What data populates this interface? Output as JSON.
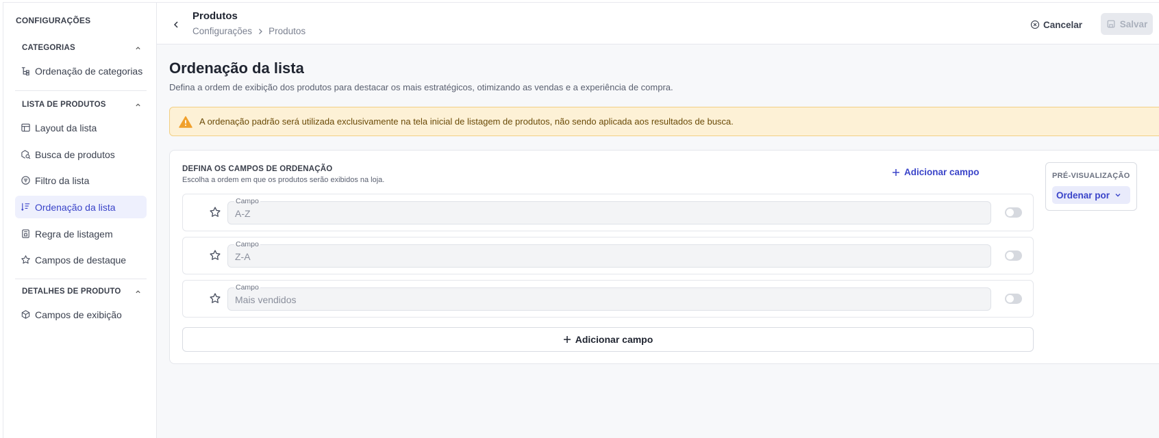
{
  "sidebar": {
    "title": "CONFIGURAÇÕES",
    "sections": [
      {
        "label": "CATEGORIAS",
        "items": [
          {
            "label": "Ordenação de categorias",
            "icon": "sort-tree-icon"
          }
        ]
      },
      {
        "label": "LISTA DE PRODUTOS",
        "items": [
          {
            "label": "Layout da lista",
            "icon": "layout-icon"
          },
          {
            "label": "Busca de produtos",
            "icon": "search-box-icon"
          },
          {
            "label": "Filtro da lista",
            "icon": "filter-icon"
          },
          {
            "label": "Ordenação da lista",
            "icon": "sort-list-icon",
            "active": true
          },
          {
            "label": "Regra de listagem",
            "icon": "rule-icon"
          },
          {
            "label": "Campos de destaque",
            "icon": "star-icon"
          }
        ]
      },
      {
        "label": "DETALHES DE PRODUTO",
        "items": [
          {
            "label": "Campos de exibição",
            "icon": "box-icon"
          }
        ]
      }
    ]
  },
  "header": {
    "title": "Produtos",
    "breadcrumb": [
      "Configurações",
      "Produtos"
    ],
    "cancel_label": "Cancelar",
    "save_label": "Salvar"
  },
  "page": {
    "title": "Ordenação da lista",
    "description": "Defina a ordem de exibição dos produtos para destacar os mais estratégicos, otimizando as vendas e a experiência de compra.",
    "alert": "A ordenação padrão será utilizada exclusivamente na tela inicial de listagem de produtos, não sendo aplicada aos resultados de busca."
  },
  "card": {
    "heading": "DEFINA OS CAMPOS DE ORDENAÇÃO",
    "subheading": "Escolha a ordem em que os produtos serão exibidos na loja.",
    "add_link_label": "Adicionar campo",
    "fields": [
      {
        "label": "Campo",
        "value": "A-Z",
        "enabled": false
      },
      {
        "label": "Campo",
        "value": "Z-A",
        "enabled": false
      },
      {
        "label": "Campo",
        "value": "Mais vendidos",
        "enabled": false
      }
    ],
    "add_button_label": "Adicionar campo",
    "preview": {
      "label": "PRÉ-VISUALIZAÇÃO",
      "select_label": "Ordenar por"
    }
  },
  "colors": {
    "accent": "#3a44c9",
    "alert_bg": "#fdf1d6",
    "alert_border": "#f2cf84",
    "warning_icon": "#f0a02c"
  }
}
